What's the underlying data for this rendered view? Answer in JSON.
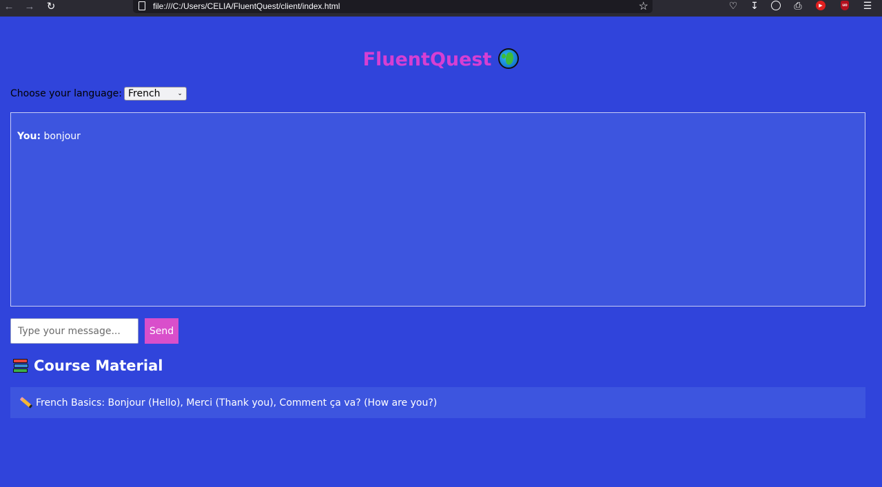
{
  "browser": {
    "url": "file:///C:/Users/CELIA/FluentQuest/client/index.html"
  },
  "app": {
    "title": "FluentQuest",
    "title_icon": "globe-icon",
    "accent_color": "#d63fd3",
    "background_color": "#3044db"
  },
  "language": {
    "label": "Choose your language:",
    "selected": "French"
  },
  "chat": {
    "messages": [
      {
        "sender": "You:",
        "text": "bonjour"
      }
    ],
    "input_placeholder": "Type your message...",
    "send_label": "Send"
  },
  "course": {
    "heading": "Course Material",
    "heading_icon": "books-icon",
    "items": [
      {
        "icon": "pencil-icon",
        "text": "French Basics: Bonjour (Hello), Merci (Thank you), Comment ça va? (How are you?)"
      }
    ]
  }
}
